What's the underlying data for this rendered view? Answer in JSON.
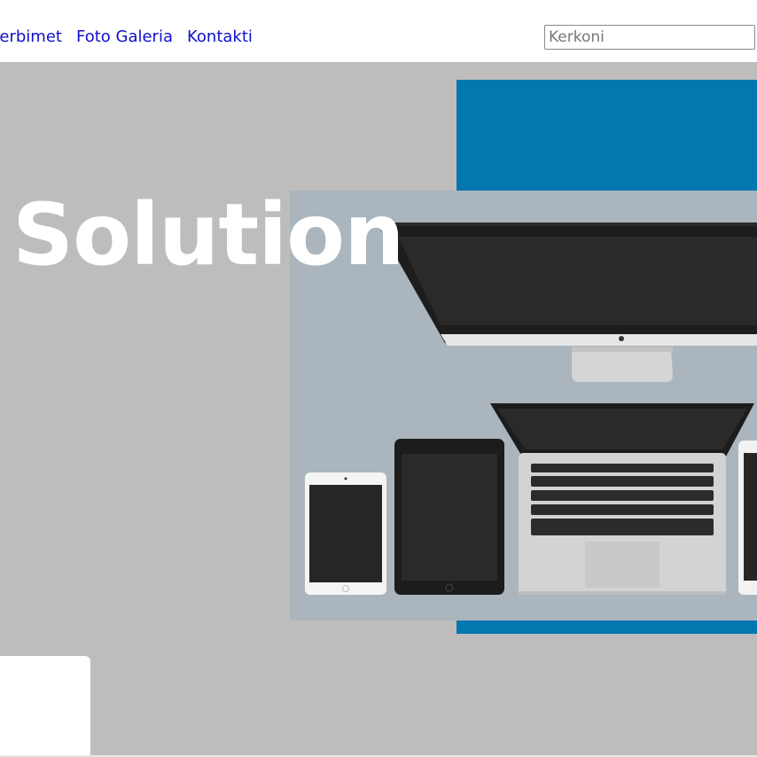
{
  "nav": {
    "items": [
      {
        "label": "herbimet"
      },
      {
        "label": "Foto Galeria"
      },
      {
        "label": "Kontakti"
      }
    ]
  },
  "search": {
    "placeholder": "Kerkoni"
  },
  "hero": {
    "title": "Solution"
  },
  "colors": {
    "link": "#1010cc",
    "hero_background": "#bebdbb",
    "accent_blue": "#0476b0",
    "image_background": "#aab5bd"
  }
}
